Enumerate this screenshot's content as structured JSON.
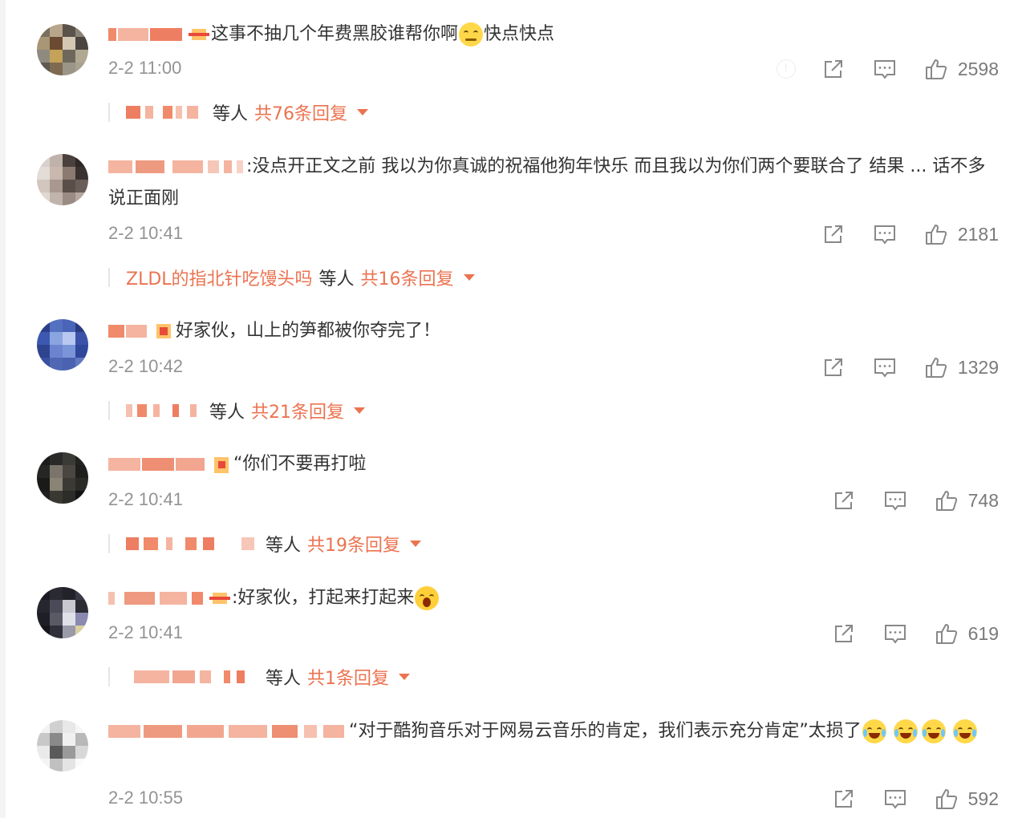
{
  "comments": [
    {
      "text": "这事不抽几个年费黑胶谁帮你啊",
      "tail": "快点快点",
      "time": "2-2 11:00",
      "likes": "2598",
      "reply_total": "共76条回复",
      "reply_named": ""
    },
    {
      "text": ":没点开正文之前 我以为你真诚的祝福他狗年快乐 而且我以为你们两个要联合了 结果 ... 话不多说正面刚",
      "tail": "",
      "time": "2-2 10:41",
      "likes": "2181",
      "reply_total": "共16条回复",
      "reply_named": "ZLDL的指北针吃馒头吗"
    },
    {
      "text": "好家伙，山上的笋都被你夺完了！",
      "tail": "",
      "time": "2-2 10:42",
      "likes": "1329",
      "reply_total": "共21条回复",
      "reply_named": ""
    },
    {
      "text": "“你们不要再打啦",
      "tail": "",
      "time": "2-2 10:41",
      "likes": "748",
      "reply_total": "共19条回复",
      "reply_named": ""
    },
    {
      "text": ":好家伙，打起来打起来",
      "tail": "",
      "time": "2-2 10:41",
      "likes": "619",
      "reply_total": "共1条回复",
      "reply_named": ""
    },
    {
      "text": "“对于酷狗音乐对于网易云音乐的肯定，我们表示充分肯定”太损了",
      "tail": "",
      "time": "2-2 10:55",
      "likes": "592",
      "reply_total": "",
      "reply_named": ""
    }
  ],
  "reply_suffix": "等人",
  "icons": {
    "share": "share-icon",
    "comment": "comment-icon",
    "like": "thumbs-up-icon",
    "report": "report-icon",
    "expand": "caret-down-icon"
  },
  "colors": {
    "accent": "#eb7350",
    "muted": "#939393",
    "text": "#333333"
  }
}
